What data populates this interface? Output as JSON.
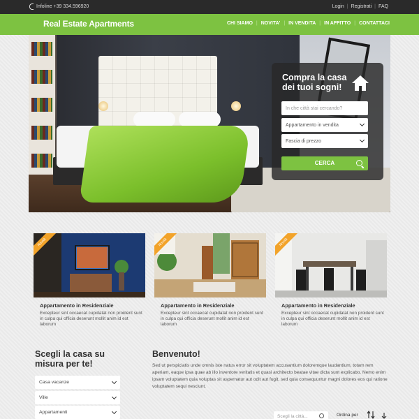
{
  "topbar": {
    "phone": "Infoline +39 334.596920",
    "links": [
      "Login",
      "Registrati",
      "FAQ"
    ]
  },
  "header": {
    "logo": "Real Estate Apartments",
    "nav": [
      "CHI SIAMO",
      "NOVITA'",
      "IN VENDITA",
      "IN AFFITTO",
      "CONTATTACI"
    ]
  },
  "search": {
    "title": "Compra la casa dei tuoi sogni!",
    "city_placeholder": "In che città stai cercando?",
    "type_value": "Appartamento in vendita",
    "price_value": "Fascia di prezzo",
    "button": "CERCA"
  },
  "cards": [
    {
      "badge": "Novità",
      "title": "Appartamento in Residenziale",
      "text": "Excepteur sint occaecat cupidatat non proident sunt in culpa qui officia deserunt mollit anim id est laborum"
    },
    {
      "badge": "Novità",
      "title": "Appartamento in Residenziale",
      "text": "Excepteur sint occaecat cupidatat non proident sunt in culpa qui officia deserunt mollit anim id est laborum"
    },
    {
      "badge": "Novità",
      "title": "Appartamento in Residenziale",
      "text": "Excepteur sint occaecat cupidatat non proident sunt in culpa qui officia deserunt mollit anim id est laborum"
    }
  ],
  "side": {
    "title": "Scegli la casa su misura per te!",
    "options": [
      "Casa vacanze",
      "Ville",
      "Appartamenti"
    ]
  },
  "welcome": {
    "title": "Benvenuto!",
    "text": "Sed ut perspiciatis unde omnis iste natus error sit voluptatem accusantium doloremque laudantium, totam rem aperiam, eaque ipsa quae ab illo inventore veritatis et quasi architecto beatae vitae dicta sunt explicabo. Nemo enim ipsam voluptatem quia voluptas sit aspernatur aut odit aut fugit, sed quia consequuntur magni dolores eos qui ratione voluptatem sequi nesciunt."
  },
  "bottom": {
    "search_placeholder": "Scegli la città...",
    "order_label": "Ordina per"
  },
  "colors": {
    "accent": "#7dc241",
    "topbar": "#2a2a2a",
    "ribbon": "#f2a32a"
  }
}
